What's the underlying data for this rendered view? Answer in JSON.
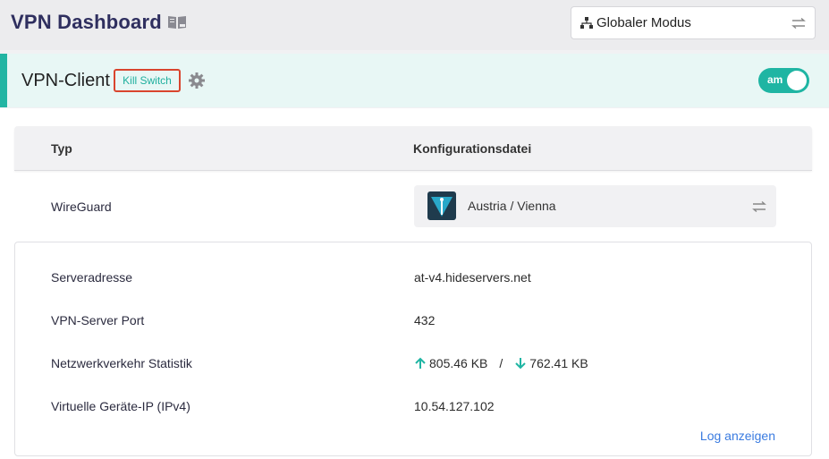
{
  "header": {
    "title": "VPN Dashboard",
    "mode_select": {
      "value": "Globaler Modus"
    }
  },
  "client": {
    "title": "VPN-Client",
    "kill_switch_label": "Kill Switch",
    "toggle_label": "am",
    "toggle_on": true
  },
  "table": {
    "headers": {
      "type": "Typ",
      "config": "Konfigurationsdatei"
    },
    "type_value": "WireGuard",
    "config_value": "Austria / Vienna"
  },
  "details": {
    "server_address": {
      "label": "Serveradresse",
      "value": "at-v4.hideservers.net"
    },
    "server_port": {
      "label": "VPN-Server Port",
      "value": "432"
    },
    "traffic": {
      "label": "Netzwerkverkehr Statistik",
      "upload": "805.46 KB",
      "separator": "/",
      "download": "762.41 KB"
    },
    "virtual_ip": {
      "label": "Virtuelle Geräte-IP (IPv4)",
      "value": "10.54.127.102"
    },
    "log_link": "Log anzeigen"
  },
  "colors": {
    "accent": "#1fb5a3",
    "title": "#2f2f5f",
    "highlight_border": "#d9452e",
    "link": "#3a7be0"
  },
  "icons": [
    "book-icon",
    "network-icon",
    "swap-icon",
    "gear-icon",
    "flag-icon",
    "arrow-up-icon",
    "arrow-down-icon"
  ]
}
